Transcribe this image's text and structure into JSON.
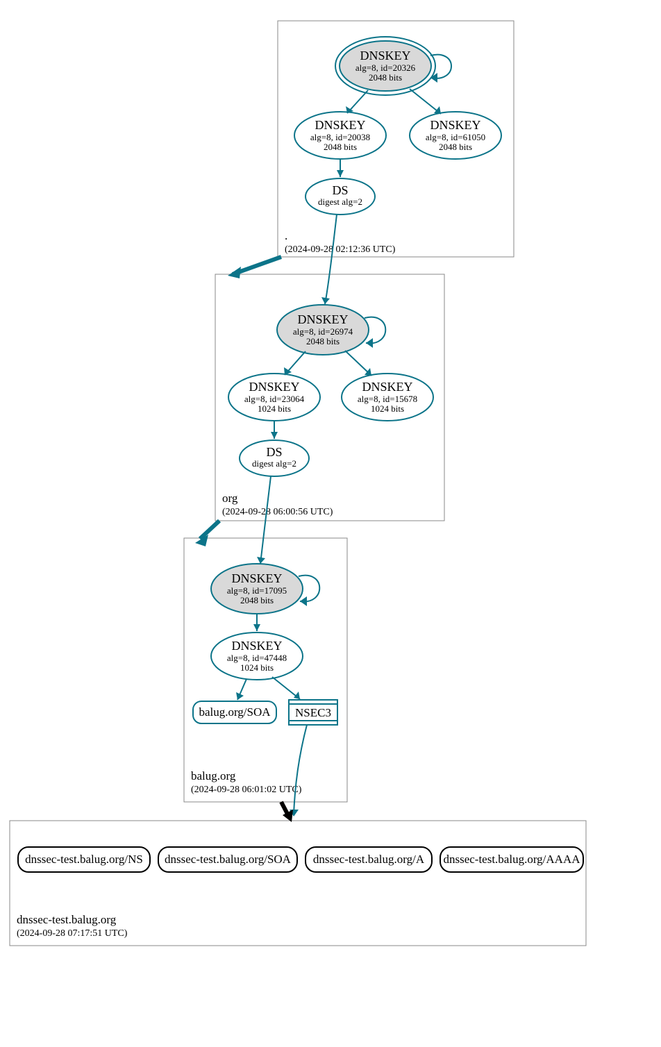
{
  "zones": {
    "root": {
      "name": ".",
      "time": "(2024-09-28 02:12:36 UTC)",
      "ksk": {
        "title": "DNSKEY",
        "line1": "alg=8, id=20326",
        "line2": "2048 bits"
      },
      "zsk1": {
        "title": "DNSKEY",
        "line1": "alg=8, id=20038",
        "line2": "2048 bits"
      },
      "zsk2": {
        "title": "DNSKEY",
        "line1": "alg=8, id=61050",
        "line2": "2048 bits"
      },
      "ds": {
        "title": "DS",
        "line1": "digest alg=2"
      }
    },
    "org": {
      "name": "org",
      "time": "(2024-09-28 06:00:56 UTC)",
      "ksk": {
        "title": "DNSKEY",
        "line1": "alg=8, id=26974",
        "line2": "2048 bits"
      },
      "zsk1": {
        "title": "DNSKEY",
        "line1": "alg=8, id=23064",
        "line2": "1024 bits"
      },
      "zsk2": {
        "title": "DNSKEY",
        "line1": "alg=8, id=15678",
        "line2": "1024 bits"
      },
      "ds": {
        "title": "DS",
        "line1": "digest alg=2"
      }
    },
    "balug": {
      "name": "balug.org",
      "time": "(2024-09-28 06:01:02 UTC)",
      "ksk": {
        "title": "DNSKEY",
        "line1": "alg=8, id=17095",
        "line2": "2048 bits"
      },
      "zsk": {
        "title": "DNSKEY",
        "line1": "alg=8, id=47448",
        "line2": "1024 bits"
      },
      "soa": "balug.org/SOA",
      "nsec": "NSEC3"
    },
    "dnssec_test": {
      "name": "dnssec-test.balug.org",
      "time": "(2024-09-28 07:17:51 UTC)",
      "rr": {
        "ns": "dnssec-test.balug.org/NS",
        "soa": "dnssec-test.balug.org/SOA",
        "a": "dnssec-test.balug.org/A",
        "aaaa": "dnssec-test.balug.org/AAAA"
      }
    }
  }
}
